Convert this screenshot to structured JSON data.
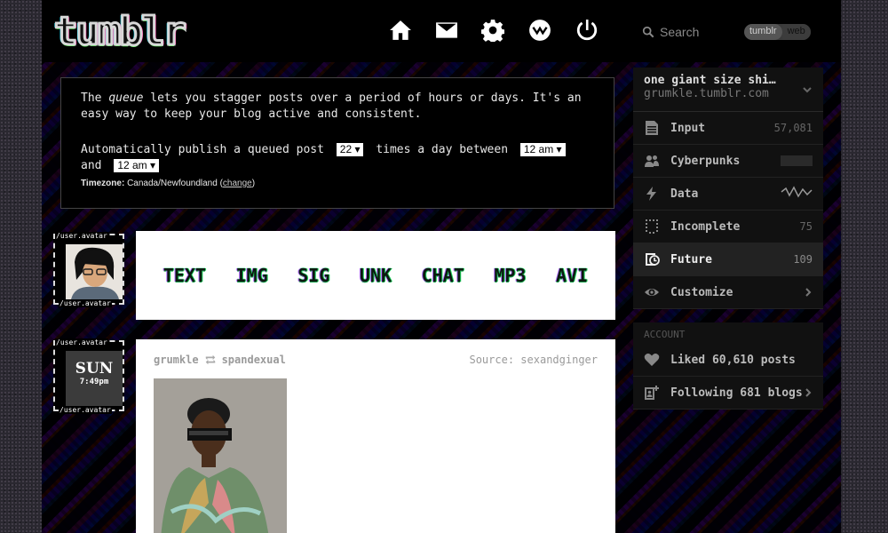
{
  "app": {
    "logo_text": "tumblr"
  },
  "header": {
    "nav_icons": [
      "home-icon",
      "mail-icon",
      "gear-icon",
      "activity-icon",
      "power-icon"
    ],
    "search_placeholder": "Search",
    "toggle": {
      "left": "tumblr",
      "right": "web"
    }
  },
  "queue": {
    "intro_prefix": "The ",
    "intro_em": "queue",
    "intro_suffix": " lets you stagger posts over a period of hours or days. It's an easy way to keep your blog active and consistent.",
    "auto_prefix": "Automatically publish a queued post",
    "times_value": "22",
    "times_suffix": "times a day between",
    "start_value": "12 am",
    "and_label": "and",
    "end_value": "12 am",
    "timezone_label": "Timezone:",
    "timezone_value": "Canada/Newfoundland",
    "change_link": "change"
  },
  "avatars": {
    "tag_top": "/user.avatar",
    "tag_bottom": "/user.avatar",
    "date_day": "SUN",
    "date_time": "7:49pm"
  },
  "post_types": [
    "TEXT",
    "IMG",
    "SIG",
    "UNK",
    "CHAT",
    "MP3",
    "AVI"
  ],
  "post": {
    "author": "grumkle",
    "reblog_from": "spandexual",
    "source_label": "Source:",
    "source_value": "sexandginger"
  },
  "sidebar": {
    "blog_title": "one giant size shi…",
    "blog_url": "grumkle.tumblr.com",
    "items": [
      {
        "label": "Input",
        "count": "57,081",
        "icon": "posts-icon"
      },
      {
        "label": "Cyberpunks",
        "count": "",
        "icon": "followers-icon"
      },
      {
        "label": "Data",
        "count": "",
        "icon": "lightning-icon"
      },
      {
        "label": "Incomplete",
        "count": "75",
        "icon": "drafts-icon"
      },
      {
        "label": "Future",
        "count": "109",
        "icon": "queue-icon"
      },
      {
        "label": "Customize",
        "count": "",
        "icon": "eye-icon"
      }
    ]
  },
  "account": {
    "title": "Account",
    "liked": "Liked 60,610 posts",
    "following": "Following 681 blogs"
  },
  "colors": {
    "topbar": "#000000",
    "sidebar": "#111111",
    "post_bg": "#ffffff"
  }
}
